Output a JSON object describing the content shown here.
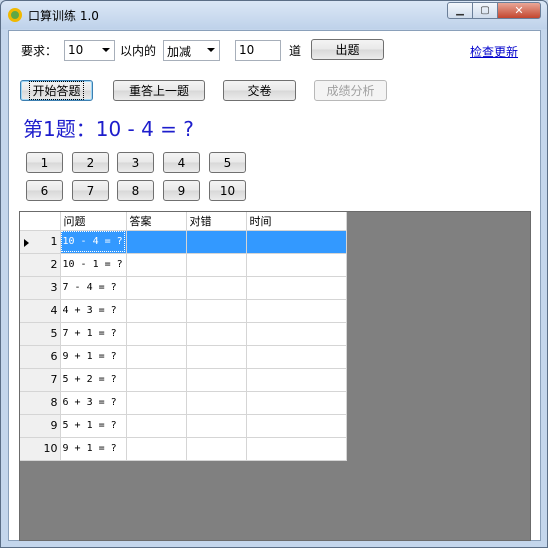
{
  "window": {
    "title": "口算训练 1.0"
  },
  "caption_buttons": {
    "minimize": "▁",
    "maximize": "▢",
    "close": "✕"
  },
  "settings": {
    "require_label": "要求：",
    "range_value": "10",
    "within_label": "以内的",
    "operation_value": "加减",
    "count_value": "10",
    "count_unit": "道",
    "generate_button": "出题",
    "check_update_link": "检查更新"
  },
  "actions": {
    "start": "开始答题",
    "redo_prev": "重答上一题",
    "submit": "交卷",
    "analysis": "成绩分析"
  },
  "question": {
    "text": "第1题：10 - 4 = ?"
  },
  "number_buttons": [
    "1",
    "2",
    "3",
    "4",
    "5",
    "6",
    "7",
    "8",
    "9",
    "10"
  ],
  "table": {
    "headers": [
      "问题",
      "答案",
      "对错",
      "时间"
    ],
    "rows": [
      {
        "num": "1",
        "question": "10 - 4 = ?",
        "answer": "",
        "correct": "",
        "time": ""
      },
      {
        "num": "2",
        "question": "10 - 1 = ?",
        "answer": "",
        "correct": "",
        "time": ""
      },
      {
        "num": "3",
        "question": "7 - 4 = ?",
        "answer": "",
        "correct": "",
        "time": ""
      },
      {
        "num": "4",
        "question": "4 + 3 = ?",
        "answer": "",
        "correct": "",
        "time": ""
      },
      {
        "num": "5",
        "question": "7 + 1 = ?",
        "answer": "",
        "correct": "",
        "time": ""
      },
      {
        "num": "6",
        "question": "9 + 1 = ?",
        "answer": "",
        "correct": "",
        "time": ""
      },
      {
        "num": "7",
        "question": "5 + 2 = ?",
        "answer": "",
        "correct": "",
        "time": ""
      },
      {
        "num": "8",
        "question": "6 + 3 = ?",
        "answer": "",
        "correct": "",
        "time": ""
      },
      {
        "num": "9",
        "question": "5 + 1 = ?",
        "answer": "",
        "correct": "",
        "time": ""
      },
      {
        "num": "10",
        "question": "9 + 1 = ?",
        "answer": "",
        "correct": "",
        "time": ""
      }
    ],
    "selected_row": 1
  },
  "colors": {
    "question_text": "#1d1dcc",
    "selection": "#3399ff",
    "grid_background": "#808080"
  }
}
